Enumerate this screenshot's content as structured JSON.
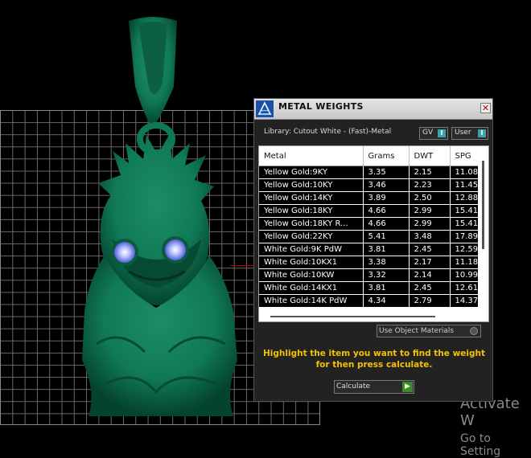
{
  "panel": {
    "title": "METAL WEIGHTS",
    "close_glyph": "✕",
    "library_label": "Library: Cutout White - (Fast)-Metal",
    "options": [
      {
        "label": "GV",
        "toggle": "I"
      },
      {
        "label": "User",
        "toggle": "I"
      }
    ],
    "table": {
      "columns": [
        "Metal",
        "Grams",
        "DWT",
        "SPG"
      ],
      "rows": [
        [
          "Yellow Gold:9KY",
          "3.35",
          "2.15",
          "11.08"
        ],
        [
          "Yellow Gold:10KY",
          "3.46",
          "2.23",
          "11.45"
        ],
        [
          "Yellow Gold:14KY",
          "3.89",
          "2.50",
          "12.88"
        ],
        [
          "Yellow Gold:18KY",
          "4.66",
          "2.99",
          "15.41"
        ],
        [
          "Yellow Gold:18KY R...",
          "4.66",
          "2.99",
          "15.41"
        ],
        [
          "Yellow Gold:22KY",
          "5.41",
          "3.48",
          "17.89"
        ],
        [
          "White Gold:9K PdW",
          "3.81",
          "2.45",
          "12.59"
        ],
        [
          "White Gold:10KX1",
          "3.38",
          "2.17",
          "11.18"
        ],
        [
          "White Gold:10KW",
          "3.32",
          "2.14",
          "10.99"
        ],
        [
          "White Gold:14KX1",
          "3.81",
          "2.45",
          "12.61"
        ],
        [
          "White Gold:14K PdW",
          "4.34",
          "2.79",
          "14.37"
        ]
      ]
    },
    "use_materials_label": "Use Object Materials",
    "hint": "Highlight the item you want to find the weight for then press calculate.",
    "calculate_label": "Calculate",
    "calculate_arrow": "▶"
  },
  "watermark": {
    "line1": "Activate W",
    "line2": "Go to Setting"
  },
  "colors": {
    "model": "#0f6b4e",
    "hint": "#f2c200",
    "gem": "#9aa6ff",
    "toggle": "#3aa3ad"
  },
  "icons": {
    "panel_icon": "metal-weights-app-icon",
    "close": "close-icon",
    "calculate": "play-arrow-icon"
  }
}
